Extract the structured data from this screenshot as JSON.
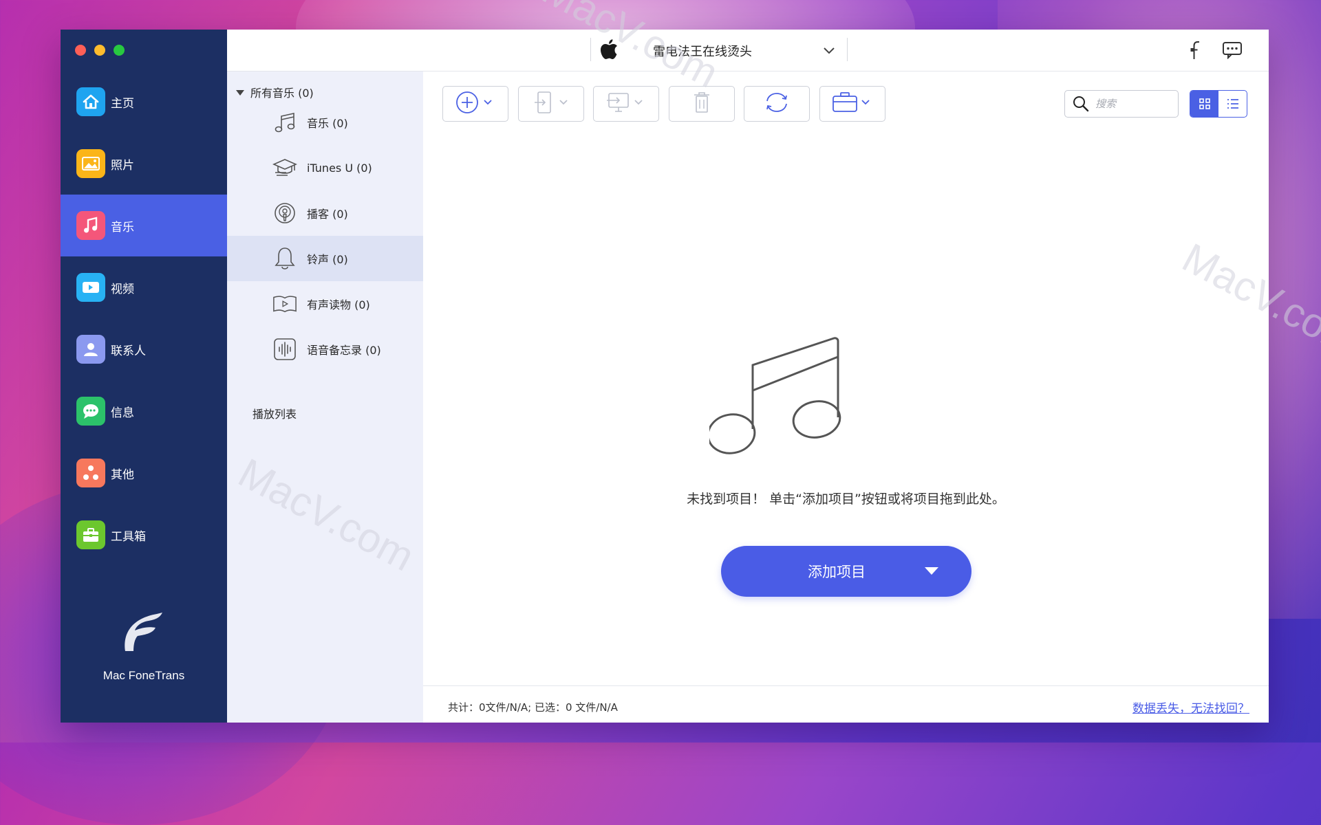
{
  "colors": {
    "sidebar_bg": "#1c2f63",
    "accent": "#4a60e4",
    "panel_bg": "#eef0fa"
  },
  "app": {
    "name": "Mac FoneTrans"
  },
  "sidebar": {
    "items": [
      {
        "label": "主页",
        "icon": "home-icon",
        "color": "#1fa4f0"
      },
      {
        "label": "照片",
        "icon": "photo-icon",
        "color": "#fbb519"
      },
      {
        "label": "音乐",
        "icon": "music-icon",
        "color": "#f4567a",
        "active": true
      },
      {
        "label": "视频",
        "icon": "video-icon",
        "color": "#28b2f4"
      },
      {
        "label": "联系人",
        "icon": "contacts-icon",
        "color": "#8b99ef"
      },
      {
        "label": "信息",
        "icon": "message-icon",
        "color": "#2cc26a"
      },
      {
        "label": "其他",
        "icon": "other-icon",
        "color": "#f7785d"
      },
      {
        "label": "工具箱",
        "icon": "toolbox-icon",
        "color": "#6cc72e"
      }
    ]
  },
  "topbar": {
    "device_name": "雷电法王在线烫头",
    "device_icon": "apple-icon"
  },
  "categories": {
    "header": "所有音乐 (0)",
    "items": [
      {
        "label": "音乐 (0)",
        "icon": "music-note-icon"
      },
      {
        "label": "iTunes U (0)",
        "icon": "graduation-cap-icon"
      },
      {
        "label": "播客 (0)",
        "icon": "podcast-icon"
      },
      {
        "label": "铃声 (0)",
        "icon": "bell-icon",
        "selected": true
      },
      {
        "label": "有声读物 (0)",
        "icon": "audiobook-icon"
      },
      {
        "label": "语音备忘录 (0)",
        "icon": "voice-memo-icon"
      }
    ],
    "playlist_header": "播放列表"
  },
  "toolbar": {
    "buttons": [
      "add-icon",
      "export-to-device-icon",
      "export-to-pc-icon",
      "trash-icon",
      "sync-icon",
      "toolbox-icon"
    ]
  },
  "search": {
    "placeholder": "搜索"
  },
  "main": {
    "empty_message": "未找到项目！ 单击“添加项目”按钮或将项目拖到此处。",
    "add_button": "添加项目"
  },
  "status": {
    "summary": "共计：0文件/N/A; 已选：0 文件/N/A",
    "link": "数据丢失，无法找回？"
  },
  "watermark": {
    "text": "MacV.com"
  }
}
